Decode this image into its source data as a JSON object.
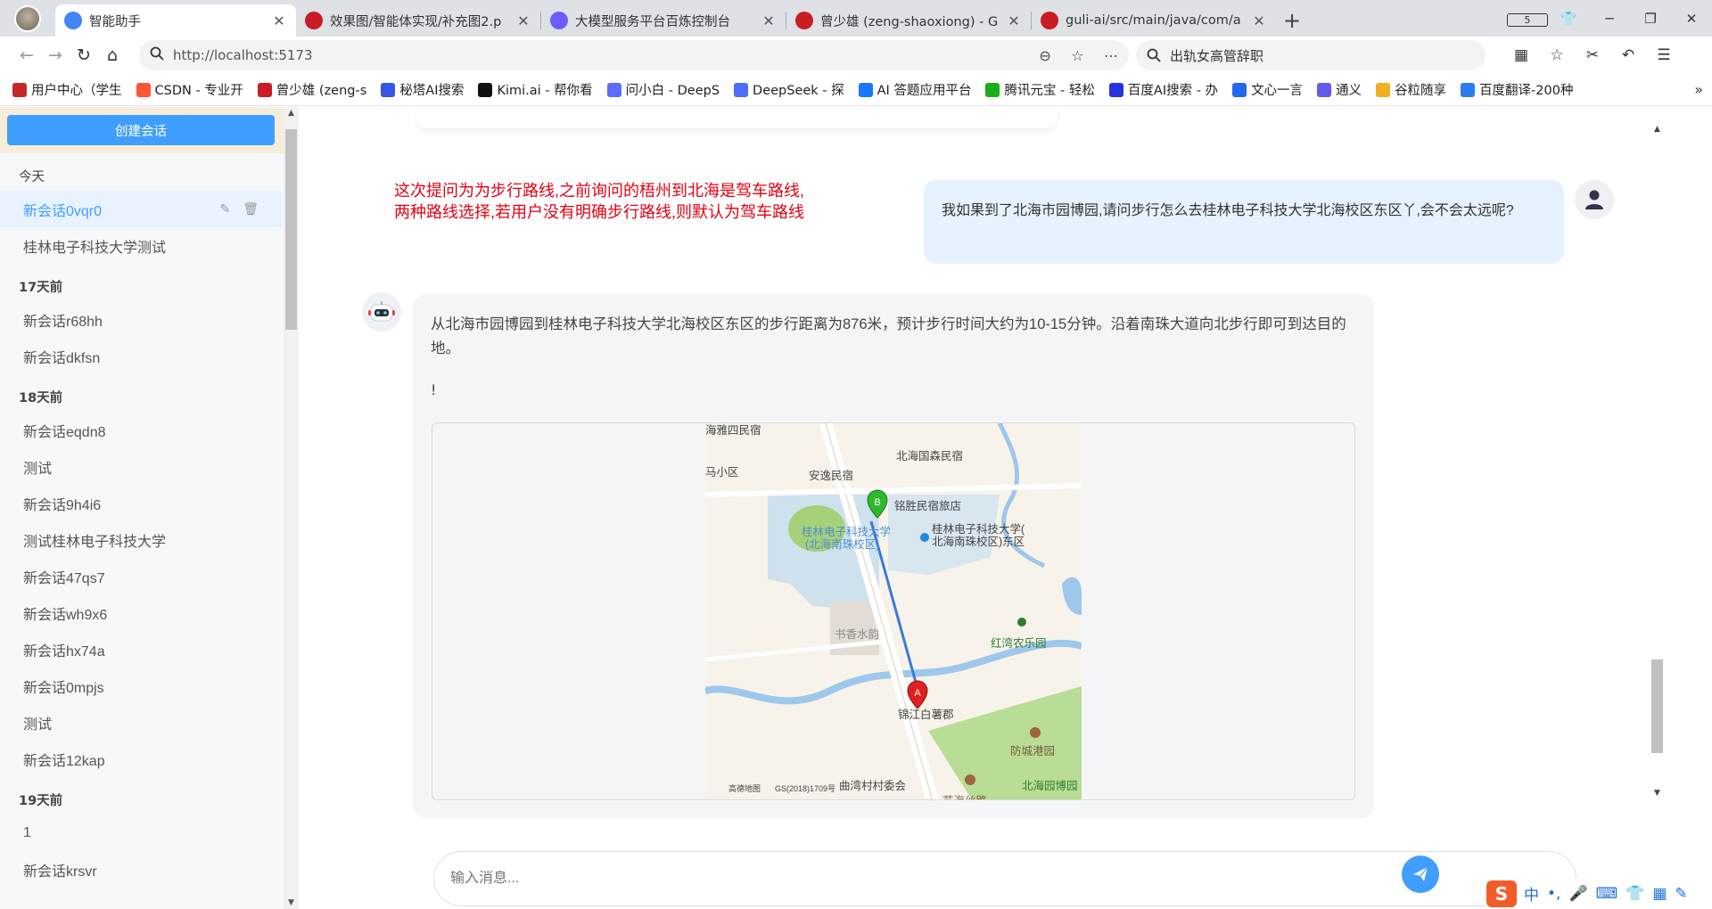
{
  "browser": {
    "tabs": [
      {
        "title": "智能助手",
        "active": true,
        "icon": "robot-icon",
        "color": "#4285f4"
      },
      {
        "title": "效果图/智能体实现/补充图2.p",
        "active": false,
        "icon": "gitee-icon",
        "color": "#c71d23"
      },
      {
        "title": "大模型服务平台百炼控制台",
        "active": false,
        "icon": "bailian-icon",
        "color": "#6b5cff"
      },
      {
        "title": "曾少雄 (zeng-shaoxiong) - G",
        "active": false,
        "icon": "gitee-icon",
        "color": "#c71d23"
      },
      {
        "title": "guli-ai/src/main/java/com/a",
        "active": false,
        "icon": "gitee-icon",
        "color": "#c71d23"
      }
    ],
    "tab_count_badge": "5",
    "url": "http://localhost:5173",
    "search_text": "出轨女高管辞职",
    "bookmarks": [
      {
        "label": "用户中心（学生",
        "color": "#c62828"
      },
      {
        "label": "CSDN - 专业开",
        "color": "#fc5531"
      },
      {
        "label": "曾少雄 (zeng-s",
        "color": "#c71d23"
      },
      {
        "label": "秘塔AI搜索",
        "color": "#3556e8"
      },
      {
        "label": "Kimi.ai - 帮你看",
        "color": "#111111"
      },
      {
        "label": "问小白 - DeepS",
        "color": "#5b6cff"
      },
      {
        "label": "DeepSeek - 探",
        "color": "#4d6bfe"
      },
      {
        "label": "AI 答题应用平台",
        "color": "#1677ff"
      },
      {
        "label": "腾讯元宝 - 轻松",
        "color": "#1aad19"
      },
      {
        "label": "百度AI搜索 - 办",
        "color": "#2932e1"
      },
      {
        "label": "文心一言",
        "color": "#2468f2"
      },
      {
        "label": "通义",
        "color": "#615ced"
      },
      {
        "label": "谷粒随享",
        "color": "#f2b01e"
      },
      {
        "label": "百度翻译-200种",
        "color": "#2b7cf0"
      }
    ]
  },
  "sidebar": {
    "create_button": "创建会话",
    "groups": [
      {
        "title": "今天",
        "items": [
          "新会话0vqr0",
          "桂林电子科技大学测试"
        ]
      },
      {
        "title": "17天前",
        "items": [
          "新会话r68hh",
          "新会话dkfsn"
        ]
      },
      {
        "title": "18天前",
        "items": [
          "新会话eqdn8",
          "测试",
          "新会话9h4i6",
          "测试桂林电子科技大学",
          "新会话47qs7",
          "新会话wh9x6",
          "新会话hx74a",
          "新会话0mpjs",
          "测试",
          "新会话12kap"
        ]
      },
      {
        "title": "19天前",
        "items": [
          "1",
          "新会话krsvr"
        ]
      }
    ],
    "active_item": "新会话0vqr0"
  },
  "chat": {
    "annotation_line1": "这次提问为为步行路线,之前询问的梧州到北海是驾车路线,",
    "annotation_line2": "两种路线选择,若用户没有明确步行路线,则默认为驾车路线",
    "user_message": "我如果到了北海市园博园,请问步行怎么去桂林电子科技大学北海校区东区丫,会不会太远呢?",
    "bot_message": "从北海市园博园到桂林电子科技大学北海校区东区的步行距离为876米，预计步行时间大约为10-15分钟。沿着南珠大道向北步行即可到达目的地。",
    "bot_message_tail": "!",
    "input_placeholder": "输入消息...",
    "map_labels": {
      "l1": "海雅四民宿",
      "l2": "北海国森民宿",
      "l3": "马小区",
      "l4": "安逸民宿",
      "l5": "铭胜民宿旅店",
      "l6": "桂林电子科技大学",
      "l7": "(北海南珠校区)",
      "l8": "桂林电子科技大学(",
      "l9": "北海南珠校区)东区",
      "l10": "书香水韵",
      "l11": "红湾农乐园",
      "l12": "锦江白薯郡",
      "l13": "防城港园",
      "l14": "北海园博园",
      "l15": "曲湾村村委会",
      "l16": "高德地图",
      "l17": "GS(2018)1709号",
      "l18": "艺海丝路",
      "marker_a": "A",
      "marker_b": "B"
    }
  },
  "ime": {
    "logo": "S",
    "mode": "中"
  }
}
